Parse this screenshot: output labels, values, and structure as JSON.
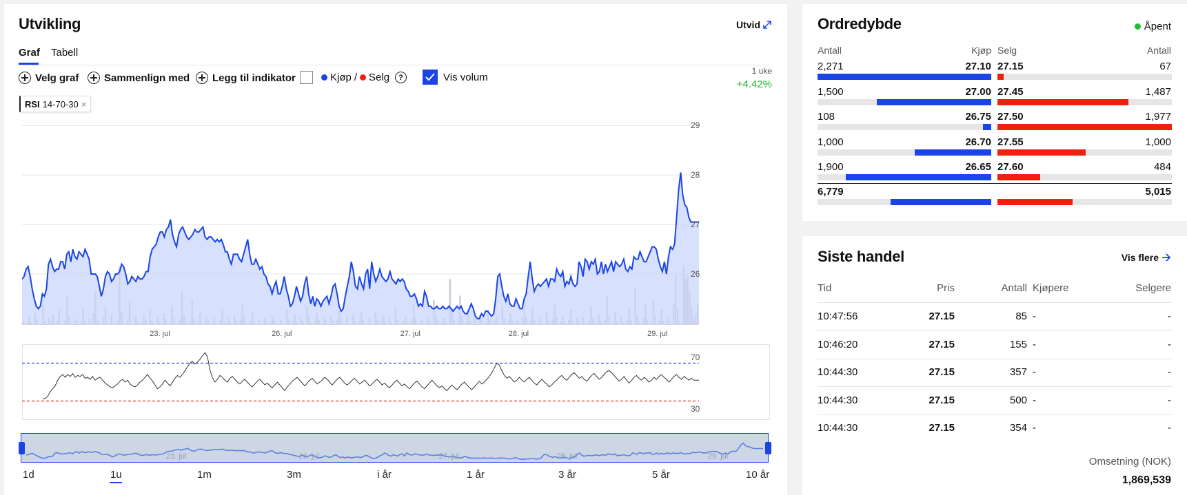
{
  "chart_card": {
    "title": "Utvikling",
    "expand_label": "Utvid",
    "tabs": [
      "Graf",
      "Tabell"
    ],
    "active_tab": "Graf",
    "toolbar": {
      "velg_graf": "Velg graf",
      "sammenlign": "Sammenlign med",
      "indikator": "Legg til indikator",
      "kjop": "Kjøp",
      "slash": "/",
      "selg": "Selg",
      "help": "?",
      "vis_volum": "Vis volum"
    },
    "period_label": "1 uke",
    "period_change": "+4.42%",
    "indicator_chip": {
      "name": "RSI",
      "params": "14-70-30",
      "close": "×"
    },
    "colors": {
      "price_line": "#1a44e6",
      "fill": "#c9d6fb",
      "buy": "#1a44e6",
      "sell": "#f0200e",
      "positive": "#20b52a"
    },
    "range_buttons": [
      "1d",
      "1u",
      "1m",
      "3m",
      "i år",
      "1 år",
      "3 år",
      "5 år",
      "10 år"
    ],
    "active_range": "1u"
  },
  "chart_data": [
    {
      "type": "area",
      "x_labels": [
        "23. jul",
        "26. jul",
        "27. jul",
        "28. jul",
        "29. jul"
      ],
      "y_ticks": [
        26,
        27,
        28,
        29
      ],
      "ylim": [
        25.0,
        29.1
      ],
      "series": [
        {
          "values": [
            25.9,
            25.95,
            26.1,
            26.15,
            25.95,
            25.7,
            25.5,
            25.35,
            25.3,
            25.35,
            25.6,
            25.55,
            25.7,
            26.2,
            26.3,
            26.15,
            26.05,
            26.1,
            26.1,
            26.25,
            26.25,
            26.1,
            26.4,
            26.45,
            26.25,
            26.5,
            26.35,
            26.3,
            26.45,
            26.4,
            26.35,
            26.5,
            26.4,
            26.3,
            26.0,
            26.0,
            26.0,
            25.95,
            25.75,
            25.55,
            25.7,
            25.95,
            26.05,
            26.0,
            25.85,
            25.9,
            26.0,
            26.0,
            26.05,
            26.2,
            26.15,
            26.0,
            25.8,
            25.85,
            25.95,
            25.9,
            25.85,
            25.95,
            25.9,
            25.9,
            25.95,
            26.05,
            26.05,
            26.35,
            26.5,
            26.55,
            26.6,
            26.75,
            26.85,
            26.85,
            26.75,
            26.9,
            26.95,
            27.1,
            26.8,
            26.65,
            26.55,
            26.8,
            26.9,
            26.95,
            26.85,
            26.75,
            26.7,
            26.75,
            26.8,
            26.9,
            26.85,
            26.85,
            26.9,
            26.95,
            26.75,
            26.7,
            26.75,
            26.75,
            26.7,
            26.65,
            26.7,
            26.65,
            26.7,
            26.6,
            26.45,
            26.45,
            26.3,
            26.2,
            26.4,
            26.4,
            26.4,
            26.3,
            26.25,
            26.4,
            26.55,
            26.7,
            26.4,
            26.2,
            26.2,
            26.3,
            26.2,
            26.1,
            26.15,
            26.0,
            25.95,
            25.8,
            25.75,
            25.6,
            25.75,
            25.85,
            25.6,
            25.6,
            25.75,
            25.95,
            25.7,
            25.55,
            25.35,
            25.4,
            25.55,
            25.75,
            25.6,
            25.45,
            25.55,
            25.8,
            25.95,
            25.6,
            25.4,
            25.55,
            25.35,
            25.5,
            25.45,
            25.35,
            25.45,
            25.5,
            25.55,
            25.4,
            25.55,
            25.75,
            25.8,
            25.6,
            25.35,
            25.25,
            25.3,
            25.55,
            25.75,
            25.95,
            26.25,
            26.05,
            25.75,
            25.7,
            25.95,
            25.8,
            25.7,
            26.0,
            26.1,
            25.7,
            26.25,
            26.0,
            25.85,
            25.95,
            26.1,
            25.95,
            25.9,
            25.85,
            25.9,
            26.05,
            25.9,
            25.85,
            25.8,
            25.9,
            25.85,
            25.9,
            25.85,
            25.7,
            25.65,
            25.55,
            25.55,
            25.6,
            25.5,
            25.35,
            25.4,
            25.35,
            25.65,
            25.55,
            25.35,
            25.35,
            25.3,
            25.3,
            25.35,
            25.3,
            25.3,
            25.35,
            25.3,
            25.3,
            25.35,
            25.3,
            25.25,
            25.3,
            25.35,
            25.3,
            25.35,
            25.25,
            25.2,
            25.2,
            25.3,
            25.4,
            25.3,
            25.15,
            25.1,
            25.1,
            25.2,
            25.15,
            25.25,
            25.25,
            25.2,
            25.15,
            25.2,
            25.5,
            25.95,
            26.0,
            25.75,
            25.55,
            25.45,
            25.6,
            25.4,
            25.35,
            25.35,
            25.5,
            25.4,
            25.3,
            25.3,
            25.5,
            25.6,
            25.95,
            26.25,
            25.9,
            25.65,
            25.75,
            25.8,
            25.75,
            25.8,
            25.85,
            25.9,
            25.75,
            25.9,
            25.9,
            25.85,
            26.1,
            26.0,
            25.95,
            26.05,
            25.75,
            25.85,
            25.8,
            25.95,
            25.8,
            25.75,
            25.8,
            26.25,
            26.15,
            25.95,
            26.3,
            26.25,
            26.1,
            26.25,
            26.2,
            26.3,
            26.0,
            26.05,
            26.25,
            26.0,
            26.2,
            26.05,
            26.15,
            26.25,
            26.05,
            26.25,
            26.2,
            26.15,
            26.2,
            26.3,
            26.1,
            26.05,
            26.15,
            26.1,
            26.35,
            26.3,
            26.3,
            26.45,
            26.35,
            26.25,
            26.25,
            26.35,
            26.45,
            26.55,
            26.55,
            26.5,
            26.3,
            26.15,
            26.05,
            26.25,
            26.0,
            26.35,
            26.55,
            26.5,
            26.6,
            27.15,
            27.7,
            28.05,
            27.6,
            27.4,
            27.35,
            27.15,
            27.05,
            27.05,
            27.05,
            27.05,
            27.05
          ]
        }
      ],
      "volume": [
        4,
        0,
        2,
        10,
        3,
        0,
        15,
        7,
        2,
        0,
        30,
        4,
        0,
        8,
        3,
        12,
        0,
        5,
        18,
        2,
        0,
        6,
        35,
        10,
        2,
        0,
        7,
        4,
        0,
        3,
        20,
        5,
        0,
        8,
        2,
        14,
        40,
        6,
        3,
        0,
        9,
        22,
        4,
        0,
        11,
        2,
        0,
        5,
        70,
        15,
        3,
        0,
        6,
        28,
        2,
        0,
        10,
        4,
        0,
        3,
        12,
        6,
        0,
        18,
        5,
        2,
        0,
        9,
        4,
        0,
        14,
        7,
        0,
        3,
        22,
        8,
        2,
        0,
        6,
        40,
        12,
        3,
        0,
        5,
        30,
        8,
        0,
        4,
        15,
        3,
        0,
        10,
        5,
        0,
        2,
        8,
        3,
        0,
        6,
        20,
        4,
        0,
        9,
        3,
        0,
        12,
        5,
        0,
        7,
        25,
        10,
        2,
        0,
        4,
        15,
        3,
        0,
        6,
        2,
        0,
        8,
        4,
        0,
        3,
        10,
        5,
        0,
        2,
        6,
        3,
        0,
        18,
        7,
        0,
        4,
        12,
        3,
        0,
        8,
        5,
        0,
        22,
        9,
        3,
        0,
        5,
        14,
        6,
        0,
        3,
        8,
        2,
        0,
        10,
        4,
        0,
        6,
        18,
        5,
        0,
        3,
        9,
        2,
        0,
        12,
        5,
        0,
        4,
        15,
        6,
        0,
        3,
        8,
        2,
        0,
        16,
        7,
        0,
        5,
        11,
        4,
        0,
        8,
        3,
        0,
        20,
        6,
        2,
        0,
        4,
        10,
        3,
        0,
        7,
        25,
        8,
        0,
        3,
        6,
        2,
        0,
        9,
        4,
        0,
        30,
        12,
        5,
        0,
        3,
        8,
        2,
        0,
        55,
        20,
        6,
        0,
        4,
        35,
        10,
        0,
        3,
        15,
        5,
        0,
        8,
        4,
        0,
        12,
        6,
        0,
        3,
        18,
        7,
        0,
        5,
        10,
        3,
        0,
        22,
        8,
        0,
        4,
        14,
        5,
        0,
        6,
        3,
        0,
        9,
        30,
        10,
        0,
        4,
        20,
        6,
        0,
        3,
        8,
        2,
        0,
        15,
        5,
        0,
        7,
        25,
        9,
        0,
        4,
        12,
        3,
        0,
        6,
        18,
        5,
        0,
        8,
        4,
        0,
        10,
        3,
        0,
        5,
        22,
        8,
        0,
        3,
        12,
        4,
        0,
        7,
        35,
        10,
        0,
        4,
        15,
        5,
        0,
        9,
        3,
        0,
        6,
        20,
        7,
        0,
        45,
        12,
        3,
        0,
        8,
        25,
        6,
        0,
        4,
        30,
        10,
        0,
        5,
        18,
        5,
        0,
        10,
        4,
        0,
        25,
        60,
        20,
        5,
        0,
        70,
        55,
        60,
        40,
        20,
        10,
        15,
        25
      ]
    },
    {
      "type": "line",
      "y_ticks": [
        30,
        70
      ],
      "ylim": [
        10,
        90
      ],
      "threshold_lines": [
        70,
        30
      ],
      "series": [
        {
          "values": [
            32,
            33,
            35,
            40,
            43,
            46,
            52,
            56,
            58,
            55,
            58,
            56,
            59,
            55,
            57,
            56,
            58,
            54,
            55,
            53,
            56,
            52,
            54,
            55,
            52,
            49,
            47,
            45,
            44,
            46,
            48,
            51,
            53,
            50,
            52,
            48,
            46,
            45,
            47,
            50,
            52,
            55,
            58,
            54,
            51,
            47,
            43,
            45,
            48,
            52,
            49,
            46,
            50,
            54,
            57,
            55,
            58,
            62,
            66,
            70,
            72,
            69,
            71,
            74,
            78,
            81,
            77,
            63,
            55,
            50,
            53,
            57,
            55,
            52,
            50,
            54,
            56,
            53,
            50,
            48,
            51,
            53,
            50,
            47,
            45,
            48,
            51,
            53,
            50,
            47,
            49,
            46,
            44,
            47,
            50,
            47,
            44,
            41,
            45,
            48,
            51,
            53,
            55,
            52,
            49,
            46,
            49,
            52,
            54,
            51,
            48,
            50,
            52,
            55,
            53,
            50,
            47,
            50,
            53,
            55,
            52,
            49,
            47,
            49,
            52,
            54,
            51,
            48,
            50,
            52,
            49,
            46,
            48,
            51,
            53,
            50,
            47,
            49,
            46,
            44,
            47,
            50,
            52,
            49,
            46,
            48,
            45,
            43,
            46,
            49,
            51,
            48,
            45,
            43,
            46,
            49,
            52,
            49,
            46,
            44,
            46,
            43,
            41,
            44,
            47,
            44,
            42,
            45,
            48,
            50,
            47,
            44,
            42,
            45,
            48,
            51,
            48,
            50,
            53,
            56,
            60,
            65,
            70,
            68,
            62,
            57,
            54,
            56,
            53,
            50,
            52,
            55,
            52,
            50,
            53,
            55,
            52,
            49,
            47,
            50,
            53,
            50,
            48,
            45,
            47,
            50,
            52,
            55,
            57,
            54,
            52,
            55,
            58,
            60,
            57,
            54,
            56,
            53,
            51,
            54,
            57,
            59,
            56,
            53,
            55,
            58,
            61,
            62,
            60,
            57,
            54,
            51,
            53,
            56,
            52,
            49,
            52,
            55,
            57,
            54,
            52,
            55,
            53,
            50,
            52,
            55,
            53,
            56,
            58,
            55,
            53,
            50,
            53,
            56,
            58,
            55,
            53,
            56,
            54,
            52,
            54,
            52,
            52,
            52
          ]
        }
      ]
    }
  ],
  "orderbook": {
    "title": "Ordredybde",
    "status": "Åpent",
    "headers": {
      "antall_left": "Antall",
      "kjop": "Kjøp",
      "selg": "Selg",
      "antall_right": "Antall"
    },
    "rows": [
      {
        "buy_qty": "2,271",
        "buy_price": "27.10",
        "sell_price": "27.15",
        "sell_qty": "67",
        "buy_frac": 1.0,
        "sell_frac": 0.034
      },
      {
        "buy_qty": "1,500",
        "buy_price": "27.00",
        "sell_price": "27.45",
        "sell_qty": "1,487",
        "buy_frac": 0.66,
        "sell_frac": 0.752
      },
      {
        "buy_qty": "108",
        "buy_price": "26.75",
        "sell_price": "27.50",
        "sell_qty": "1,977",
        "buy_frac": 0.048,
        "sell_frac": 1.0
      },
      {
        "buy_qty": "1,000",
        "buy_price": "26.70",
        "sell_price": "27.55",
        "sell_qty": "1,000",
        "buy_frac": 0.44,
        "sell_frac": 0.506
      },
      {
        "buy_qty": "1,900",
        "buy_price": "26.65",
        "sell_price": "27.60",
        "sell_qty": "484",
        "buy_frac": 0.837,
        "sell_frac": 0.245
      }
    ],
    "total": {
      "buy_qty": "6,779",
      "sell_qty": "5,015",
      "buy_frac": 0.58,
      "sell_frac": 0.43
    }
  },
  "trades": {
    "title": "Siste handel",
    "more_label": "Vis flere",
    "headers": {
      "tid": "Tid",
      "pris": "Pris",
      "antall": "Antall",
      "kjopere": "Kjøpere",
      "selgere": "Selgere"
    },
    "rows": [
      {
        "tid": "10:47:56",
        "pris": "27.15",
        "antall": "85",
        "kjoper": "-",
        "selger": "-"
      },
      {
        "tid": "10:46:20",
        "pris": "27.15",
        "antall": "155",
        "kjoper": "-",
        "selger": "-"
      },
      {
        "tid": "10:44:30",
        "pris": "27.15",
        "antall": "357",
        "kjoper": "-",
        "selger": "-"
      },
      {
        "tid": "10:44:30",
        "pris": "27.15",
        "antall": "500",
        "kjoper": "-",
        "selger": "-"
      },
      {
        "tid": "10:44:30",
        "pris": "27.15",
        "antall": "354",
        "kjoper": "-",
        "selger": "-"
      }
    ],
    "turnover_label": "Omsetning (NOK)",
    "turnover_value": "1,869,539"
  }
}
